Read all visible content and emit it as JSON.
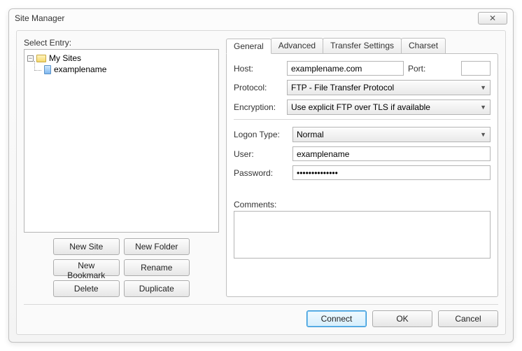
{
  "window": {
    "title": "Site Manager",
    "close_glyph": "✕"
  },
  "left": {
    "select_label": "Select Entry:",
    "tree": {
      "root": "My Sites",
      "child": "examplename"
    },
    "buttons": {
      "new_site": "New Site",
      "new_folder": "New Folder",
      "new_bookmark": "New Bookmark",
      "rename": "Rename",
      "delete": "Delete",
      "duplicate": "Duplicate"
    }
  },
  "tabs": {
    "general": "General",
    "advanced": "Advanced",
    "transfer": "Transfer Settings",
    "charset": "Charset"
  },
  "general": {
    "host_label": "Host:",
    "host_value": "examplename.com",
    "port_label": "Port:",
    "port_value": "",
    "protocol_label": "Protocol:",
    "protocol_value": "FTP - File Transfer Protocol",
    "encryption_label": "Encryption:",
    "encryption_value": "Use explicit FTP over TLS if available",
    "logon_label": "Logon Type:",
    "logon_value": "Normal",
    "user_label": "User:",
    "user_value": "examplename",
    "password_label": "Password:",
    "password_value": "••••••••••••••",
    "comments_label": "Comments:",
    "comments_value": ""
  },
  "footer": {
    "connect": "Connect",
    "ok": "OK",
    "cancel": "Cancel"
  }
}
